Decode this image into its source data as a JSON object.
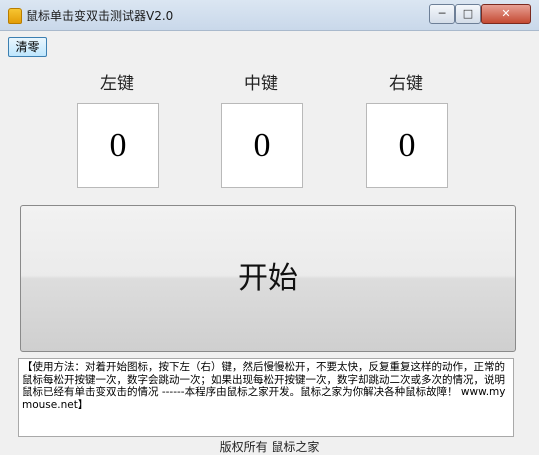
{
  "window": {
    "title": "鼠标单击变双击测试器V2.0",
    "minimize": "─",
    "maximize": "□",
    "close": "✕"
  },
  "toolbar": {
    "clear_label": "清零"
  },
  "keys": [
    {
      "label": "左键",
      "count": "0"
    },
    {
      "label": "中键",
      "count": "0"
    },
    {
      "label": "右键",
      "count": "0"
    }
  ],
  "start_label": "开始",
  "instructions": "【使用方法：对着开始图标，按下左（右）键，然后慢慢松开，不要太快，反复重复这样的动作，正常的鼠标每松开按键一次，数字会跳动一次；如果出现每松开按键一次，数字却跳动二次或多次的情况，说明鼠标已经有单击变双击的情况 ------本程序由鼠标之家开发。鼠标之家为你解决各种鼠标故障！ www.mymouse.net】",
  "footer": "版权所有 鼠标之家",
  "icons": {
    "app": "lock-icon"
  }
}
